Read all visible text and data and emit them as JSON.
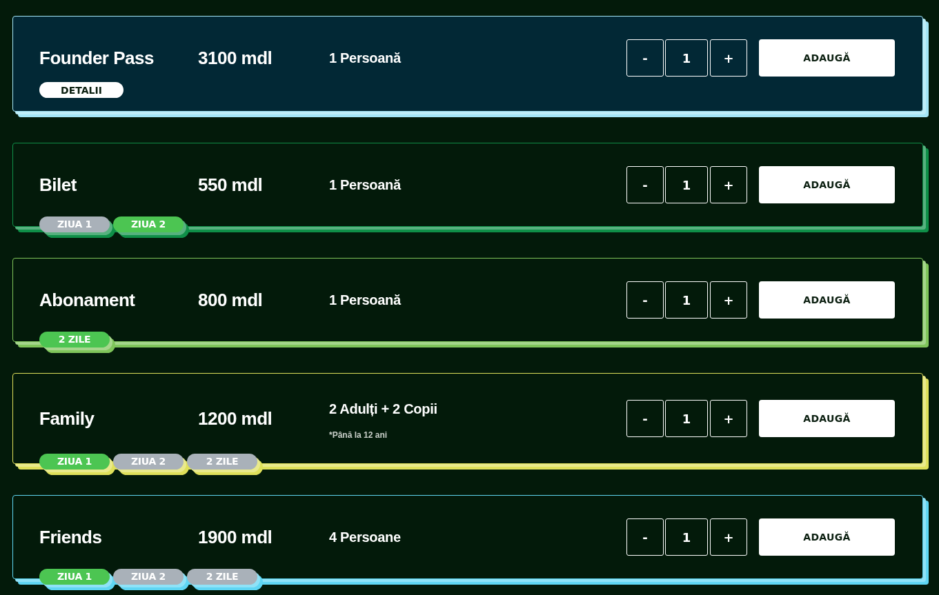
{
  "tickets": [
    {
      "name": "Founder Pass",
      "price": "3100 mdl",
      "persons": "1 Persoană",
      "color": "#a4e6f7",
      "featured": true,
      "details_button": "DETALII",
      "decrement": "-",
      "quantity": "1",
      "increment": "+",
      "add_button": "ADAUGĂ"
    },
    {
      "name": "Bilet",
      "price": "550 mdl",
      "persons": "1 Persoană",
      "color": "#0f8f48",
      "featured": false,
      "decrement": "-",
      "quantity": "1",
      "increment": "+",
      "add_button": "ADAUGĂ",
      "tags": [
        {
          "label": "ZIUA 1",
          "color": "#a9b1b9"
        },
        {
          "label": "ZIUA 2",
          "color": "#4cc552"
        }
      ]
    },
    {
      "name": "Abonament",
      "price": "800 mdl",
      "persons": "1 Persoană",
      "color": "#7fc45a",
      "featured": false,
      "decrement": "-",
      "quantity": "1",
      "increment": "+",
      "add_button": "ADAUGĂ",
      "tags": [
        {
          "label": "2 ZILE",
          "color": "#4cc552"
        }
      ]
    },
    {
      "name": "Family",
      "price": "1200 mdl",
      "persons": "2 Adulți + 2 Copii",
      "note": "*Până la 12 ani",
      "color": "#dfe05a",
      "featured": false,
      "decrement": "-",
      "quantity": "1",
      "increment": "+",
      "add_button": "ADAUGĂ",
      "tags": [
        {
          "label": "ZIUA 1",
          "color": "#4cc552"
        },
        {
          "label": "ZIUA 2",
          "color": "#a9b1b9"
        },
        {
          "label": "2 ZILE",
          "color": "#a9b1b9"
        }
      ]
    },
    {
      "name": "Friends",
      "price": "1900 mdl",
      "persons": "4 Persoane",
      "color": "#5fd6f3",
      "featured": false,
      "decrement": "-",
      "quantity": "1",
      "increment": "+",
      "add_button": "ADAUGĂ",
      "tags": [
        {
          "label": "ZIUA 1",
          "color": "#4cc552"
        },
        {
          "label": "ZIUA 2",
          "color": "#a9b1b9"
        },
        {
          "label": "2 ZILE",
          "color": "#a9b1b9"
        }
      ]
    }
  ]
}
